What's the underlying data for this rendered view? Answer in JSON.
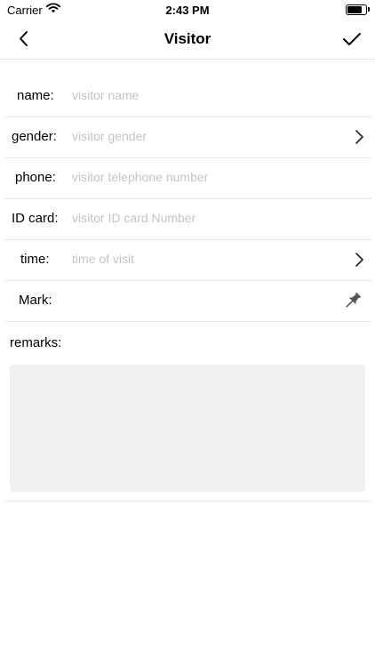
{
  "status_bar": {
    "carrier": "Carrier",
    "time": "2:43 PM",
    "battery_level": 0.9
  },
  "nav": {
    "title": "Visitor",
    "back_icon": "chevron-left-icon",
    "done_icon": "checkmark-icon"
  },
  "form": {
    "name": {
      "label": "name:",
      "placeholder": "visitor name",
      "value": ""
    },
    "gender": {
      "label": "gender:",
      "placeholder": "visitor gender",
      "value": "",
      "icon": "chevron-right-icon"
    },
    "phone": {
      "label": "phone:",
      "placeholder": "visitor telephone number",
      "value": ""
    },
    "id_card": {
      "label": "ID card:",
      "placeholder": "visitor ID card Number",
      "value": ""
    },
    "time": {
      "label": "time:",
      "placeholder": "time of visit",
      "value": "",
      "icon": "chevron-right-icon"
    },
    "mark": {
      "label": "Mark:",
      "icon": "pushpin-icon"
    },
    "remarks": {
      "label": "remarks:",
      "value": ""
    }
  },
  "colors": {
    "placeholder": "#c4c4c4",
    "divider": "#e6e6e6",
    "remarks_background": "#f0f0f0",
    "icon_gray": "#555555"
  }
}
